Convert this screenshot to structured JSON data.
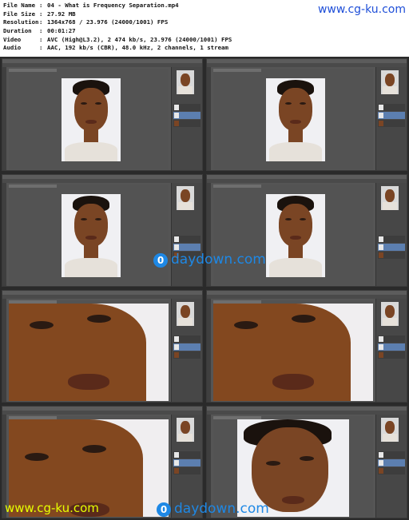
{
  "header": {
    "fields": [
      {
        "key": "File Name",
        "value": "04 - What is Frequency Separation.mp4"
      },
      {
        "key": "File Size",
        "value": "27.92 MB"
      },
      {
        "key": "Resolution",
        "value": "1364x768 / 23.976 (24000/1001) FPS"
      },
      {
        "key": "Duration",
        "value": "00:01:27"
      },
      {
        "key": "Video",
        "value": "AVC (High@L3.2), 2 474 kb/s, 23.976 (24000/1001) FPS"
      },
      {
        "key": "Audio",
        "value": "AAC, 192 kb/s (CBR), 48.0 kHz, 2 channels, 1 stream"
      }
    ],
    "watermark": "www.cg-ku.com"
  },
  "watermarks": {
    "middle_logo": "0",
    "middle_text": "daydown.com",
    "bottom_left": "www.cg-ku.com",
    "bottom_logo": "0",
    "bottom_text": "daydown.com"
  },
  "colors": {
    "background": "#2a2a2a",
    "photoshop_ui": "#555555",
    "selected_layer": "#5c7fb0",
    "watermark_blue": "#1f4fd8",
    "watermark_yellow": "#e6ff00"
  },
  "thumbnails": [
    {
      "view": "full"
    },
    {
      "view": "full"
    },
    {
      "view": "full"
    },
    {
      "view": "full"
    },
    {
      "view": "zoom"
    },
    {
      "view": "zoom"
    },
    {
      "view": "zoom"
    },
    {
      "view": "zoom-wide"
    }
  ]
}
